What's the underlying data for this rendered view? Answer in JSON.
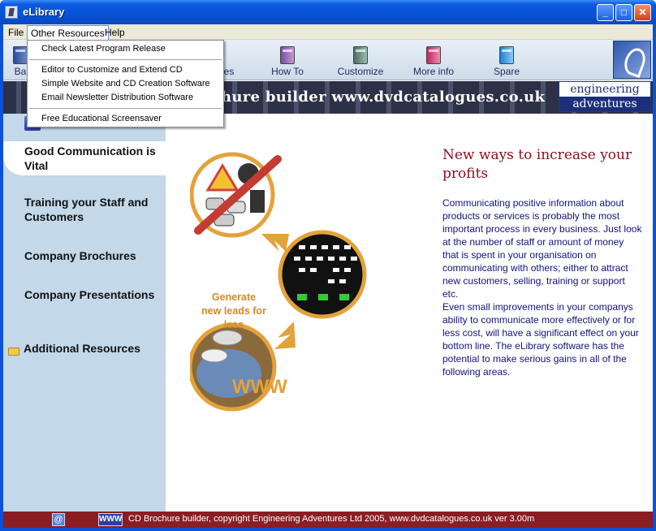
{
  "window": {
    "title": "eLibrary"
  },
  "menubar": {
    "file": "File",
    "other_resources": "Other Resources",
    "help": "Help"
  },
  "dropdown": {
    "items": [
      "Check Latest Program Release",
      "Editor to Customize and Extend CD",
      "Simple Website and CD Creation Software",
      "Email Newsletter Distribution Software",
      "Free Educational Screensaver"
    ]
  },
  "toolbar": {
    "back": "Ba",
    "resources": "es",
    "howto": "How To",
    "customize": "Customize",
    "moreinfo": "More info",
    "spare": "Spare"
  },
  "banner": {
    "text": "hure builder  www.dvdcatalogues.co.uk",
    "brand_line1": "engineering",
    "brand_line2": "adventures"
  },
  "sidebar": {
    "items": [
      "Good Communication is Vital",
      "Training your Staff and Customers",
      "Company Brochures",
      "Company Presentations",
      "Additional Resources"
    ]
  },
  "main": {
    "headline": "New ways to increase your profits",
    "body": "Communicating positive information about products or services is probably the most important process in every business. Just look at the number of staff or amount of money that is spent in your organisation on communicating with others; either to attract new customers, selling, training or support etc.",
    "body2": "Even small improvements in your companys ability to communicate more effectively or for less cost, will have a significant effect on your bottom line. The eLibrary software has the potential to make serious gains in all of the following areas.",
    "leads_text": "Generate new leads for less"
  },
  "statusbar": {
    "www_label": "WWW",
    "email_icon_glyph": "@",
    "text": "CD Brochure builder, copyright Engineering Adventures Ltd 2005,  www.dvdcatalogues.co.uk ver 3.00m"
  },
  "colors": {
    "sidebar_bg": "#c3d8e9",
    "headline": "#8a1020",
    "body_text": "#12127a",
    "statusbar_bg": "#8b1e23",
    "titlebar": "#0752d6",
    "illustration_orange": "#e3a23a"
  }
}
